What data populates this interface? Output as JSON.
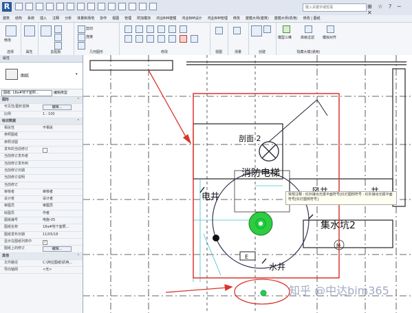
{
  "app": {
    "logo_text": "R",
    "search_placeholder": "键入关键字或短语",
    "window_controls": "⊞ ☆ ? ─ ✕"
  },
  "tabs": [
    "建筑",
    "结构",
    "系统",
    "插入",
    "注释",
    "分析",
    "体量和场地",
    "协作",
    "视图",
    "管理",
    "附加模块",
    "鸿业BIM建模",
    "鸿业BIM设计",
    "鸿业BIM管理",
    "修改",
    "建模大师(建筑)",
    "建模大师(机电)",
    "修改 | 图纸"
  ],
  "ribbon": {
    "groups": [
      {
        "label": "选择",
        "items": [
          "修改"
        ]
      },
      {
        "label": "属性",
        "items": []
      },
      {
        "label": "剪贴板",
        "items": [
          "粘贴",
          "剪切",
          "连接端切割"
        ]
      },
      {
        "label": "几何图形",
        "items": [
          "剪切",
          "连接"
        ]
      },
      {
        "label": "修改",
        "items": []
      },
      {
        "label": "视图",
        "items": []
      },
      {
        "label": "测量",
        "items": []
      },
      {
        "label": "创建",
        "items": []
      },
      {
        "label": "隐藏大模(通用)",
        "items": [
          "模型三维",
          "高级过滤",
          "模拟对齐"
        ]
      }
    ]
  },
  "properties": {
    "header": "属性",
    "type_name": "图纸",
    "selector_value": "图纸: 18a#地下室照...",
    "edit_type_label": "编辑类型",
    "sections": [
      {
        "name": "图形",
        "rows": [
          {
            "key": "可见性/图形替换",
            "value": "编辑...",
            "kind": "button"
          },
          {
            "key": "比例",
            "value": "1 : 100",
            "kind": "text"
          }
        ]
      },
      {
        "name": "标识数据",
        "rows": [
          {
            "key": "相关性",
            "value": "不相关",
            "kind": "text"
          },
          {
            "key": "参照图纸",
            "value": "",
            "kind": "text"
          },
          {
            "key": "参照详图",
            "value": "",
            "kind": "text"
          },
          {
            "key": "发布的当前修订",
            "value": "",
            "kind": "check"
          },
          {
            "key": "当前修订发布者",
            "value": "",
            "kind": "text"
          },
          {
            "key": "当前修订发布到",
            "value": "",
            "kind": "text"
          },
          {
            "key": "当前修订日期",
            "value": "",
            "kind": "text"
          },
          {
            "key": "当前修订说明",
            "value": "",
            "kind": "text"
          },
          {
            "key": "当前修订",
            "value": "",
            "kind": "text"
          },
          {
            "key": "审核者",
            "value": "审核者",
            "kind": "text"
          },
          {
            "key": "设计者",
            "value": "设计者",
            "kind": "text"
          },
          {
            "key": "审图员",
            "value": "审图员",
            "kind": "text"
          },
          {
            "key": "绘图员",
            "value": "作者",
            "kind": "text"
          },
          {
            "key": "图纸编号",
            "value": "电施-05",
            "kind": "text"
          },
          {
            "key": "图纸名称",
            "value": "18a#地下室照...",
            "kind": "text"
          },
          {
            "key": "图纸发布日期",
            "value": "11/05/18",
            "kind": "text"
          },
          {
            "key": "显示在图纸列表中",
            "value": "✓",
            "kind": "check"
          },
          {
            "key": "图纸上的修订",
            "value": "编辑...",
            "kind": "button"
          }
        ]
      },
      {
        "name": "其他",
        "rows": [
          {
            "key": "文件路径",
            "value": "C:\\阿拉图纸\\机电...",
            "kind": "text"
          },
          {
            "key": "导向轴网",
            "value": "<无>",
            "kind": "text"
          }
        ]
      }
    ]
  },
  "drawing": {
    "labels": {
      "section": "剖面 2",
      "elevator": "消防电梯",
      "shaft_elec": "电井",
      "sump": "集水坑2",
      "water_shaft": "水井",
      "e_box": "E",
      "m_mark": "M",
      "window1": "风井",
      "window2": "井"
    },
    "highlight_color": "#d9352b",
    "equipment_color": "#2ecc40"
  },
  "tooltip": "常规注释 : 红外接出光报平面符号[红灯图例符号 : 红外接出光报平面符号[红灯图例符号]",
  "watermark": "知乎 @中达bim365"
}
